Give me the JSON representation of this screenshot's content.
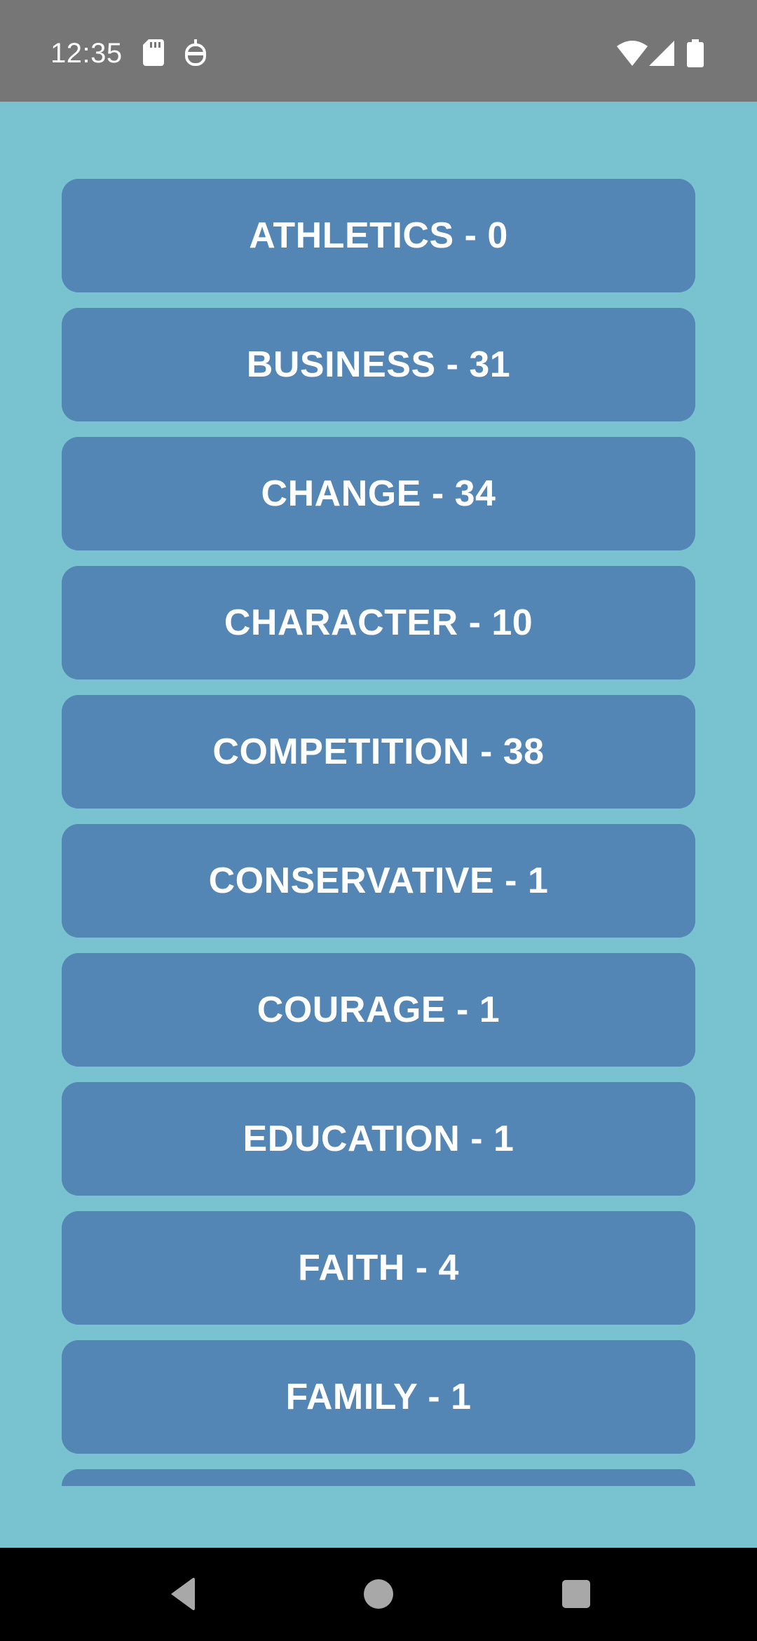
{
  "status_bar": {
    "time": "12:35",
    "icons": [
      "sd-card-icon",
      "robot-icon",
      "wifi-icon",
      "cellular-signal-icon",
      "battery-icon"
    ]
  },
  "categories": [
    {
      "label": "ATHLETICS - 0"
    },
    {
      "label": "BUSINESS - 31"
    },
    {
      "label": "CHANGE - 34"
    },
    {
      "label": "CHARACTER - 10"
    },
    {
      "label": "COMPETITION - 38"
    },
    {
      "label": "CONSERVATIVE - 1"
    },
    {
      "label": "COURAGE - 1"
    },
    {
      "label": "EDUCATION - 1"
    },
    {
      "label": "FAITH - 4"
    },
    {
      "label": "FAMILY - 1"
    },
    {
      "label": ""
    }
  ],
  "nav_bar": {
    "icons": [
      "back-icon",
      "home-icon",
      "recents-icon"
    ]
  },
  "colors": {
    "background": "#79c2d0",
    "button": "#5385b5",
    "button_text": "#ffffff",
    "status_bar": "#767676",
    "nav_bar": "#000000"
  }
}
